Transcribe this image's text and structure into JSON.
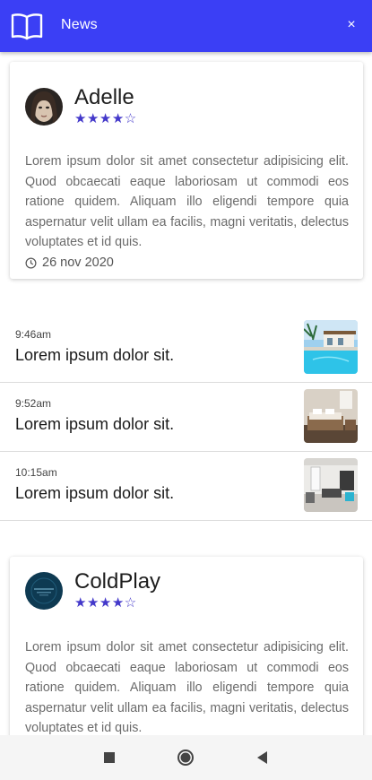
{
  "header": {
    "title": "News",
    "close_glyph": "×",
    "book_icon": "open-book-icon",
    "bg_color": "#3b3ff5"
  },
  "cards": [
    {
      "name": "Adelle",
      "rating": 4.5,
      "stars": "★★★★☆",
      "body": "Lorem ipsum dolor sit amet consectetur adipisicing elit. Quod obcaecati eaque laboriosam ut commodi eos ratione quidem. Aliquam illo eligendi tempore quia aspernatur velit ullam ea facilis, magni veritatis, delectus voluptates et id quis.",
      "date": "26 nov 2020"
    },
    {
      "name": "ColdPlay",
      "rating": 4.5,
      "stars": "★★★★☆",
      "body": "Lorem ipsum dolor sit amet consectetur adipisicing elit. Quod obcaecati eaque laboriosam ut commodi eos ratione quidem. Aliquam illo eligendi tempore quia aspernatur velit ullam ea facilis, magni veritatis, delectus voluptates et id quis."
    }
  ],
  "news": [
    {
      "time": "9:46am",
      "headline": "Lorem ipsum dolor sit."
    },
    {
      "time": "9:52am",
      "headline": "Lorem ipsum dolor sit."
    },
    {
      "time": "10:15am",
      "headline": "Lorem ipsum dolor sit."
    }
  ],
  "system_nav": {
    "recents_icon": "square-icon",
    "home_icon": "circle-icon",
    "back_icon": "triangle-back-icon"
  },
  "colors": {
    "accent": "#3b3ff5",
    "star": "#4338ca"
  }
}
